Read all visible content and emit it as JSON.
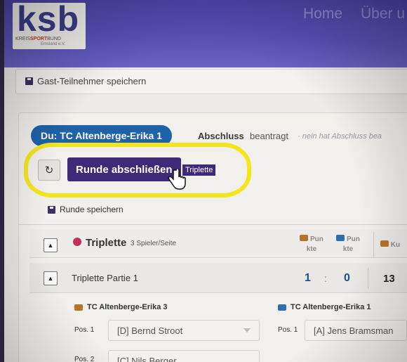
{
  "brand": {
    "logo_text": "ksb",
    "logo_sub_prefix": "KREIS",
    "logo_sub_bold": "SPORT",
    "logo_sub_suffix": "BUND",
    "logo_region": "Emsland e.V."
  },
  "nav": {
    "home": "Home",
    "about": "Über u"
  },
  "guest": {
    "save_label": "Gast-Teilnehmer speichern"
  },
  "status": {
    "team_pill": "Du: TC Altenberge-Erika 1",
    "abschluss": "Abschluss",
    "beantragt": "beantragt",
    "faded_text": "· nein hat Abschluss bea"
  },
  "actions": {
    "refresh_icon": "↻",
    "finish_round": "Runde abschließen",
    "finish_tag": "Triplette",
    "save_round": "Runde speichern"
  },
  "table": {
    "expand_icon": "▲",
    "category_title": "Triplette",
    "category_sub": "3 Spieler/Seite",
    "col1_l1": "Pun",
    "col1_l2": "kte",
    "col2_l1": "Pun",
    "col2_l2": "kte",
    "col3": "Ku",
    "match_label": "Triplette Partie 1",
    "score_left": "1",
    "score_colon": ":",
    "score_right": "0",
    "kugeln": "13"
  },
  "teams": {
    "left": "TC Altenberge-Erika 3",
    "right": "TC Altenberge-Erika 1"
  },
  "positions": {
    "pos1_left_label": "Pos. 1",
    "pos1_left_player": "[D] Bernd Stroot",
    "pos1_right_label": "Pos. 1",
    "pos1_right_player": "[A] Jens Bramsman",
    "pos2_left_label": "Pos. 2",
    "pos2_left_player": "[C] Nils Berger"
  },
  "colors": {
    "nav_purple": "#5a52b8",
    "pill_blue": "#1e62a8",
    "button_purple": "#3d2a78",
    "highlight_yellow": "#f5e51c",
    "score_blue": "#1f4f8f"
  }
}
